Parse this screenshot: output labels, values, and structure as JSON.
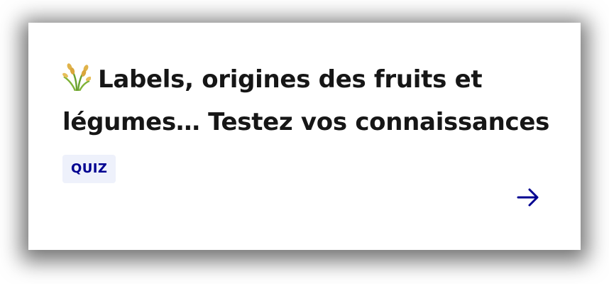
{
  "card": {
    "title": "Labels, origines des fruits et légumes… Testez vos connaissances",
    "title_icon": "sheaf-of-rice-emoji",
    "badge": "QUIZ",
    "link_icon": "arrow-right-icon"
  },
  "colors": {
    "accent": "#000091",
    "badge_bg": "#eef1fb",
    "text": "#161616"
  }
}
